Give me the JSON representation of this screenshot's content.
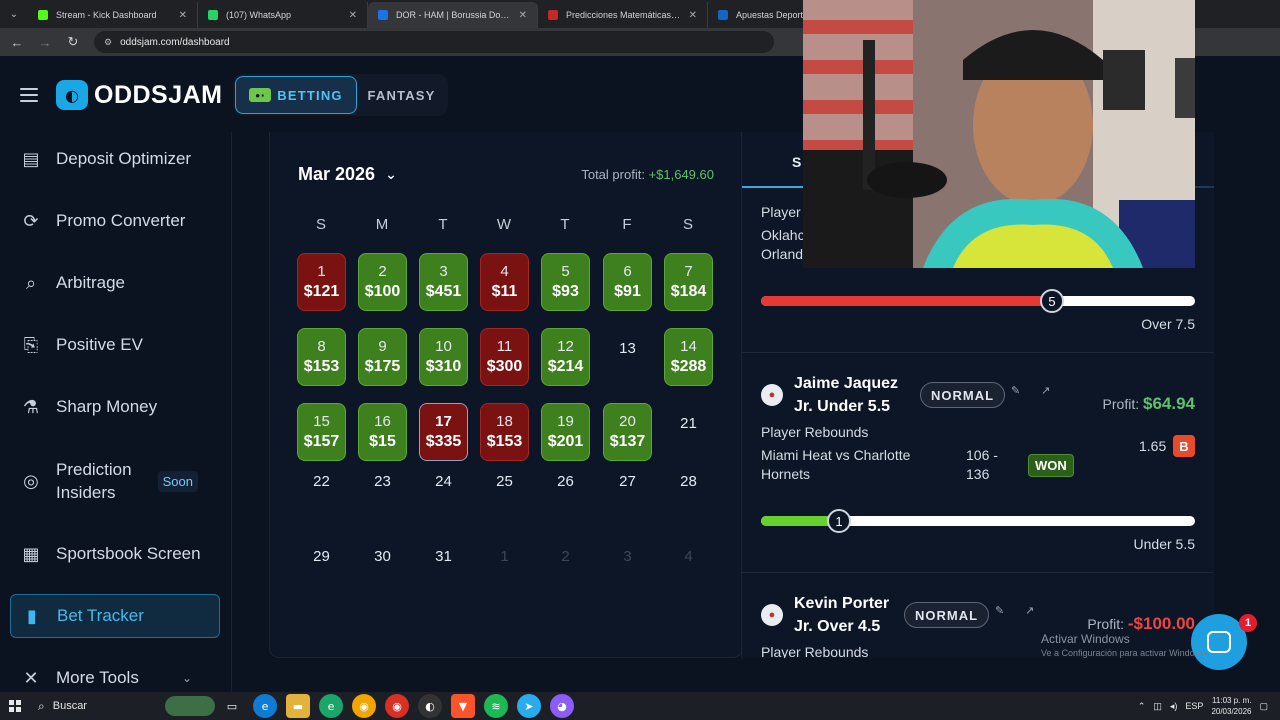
{
  "browser": {
    "tabs": [
      {
        "title": "Stream - Kick Dashboard",
        "color": "#53fc18",
        "active": false
      },
      {
        "title": "(107) WhatsApp",
        "color": "#25d366",
        "active": false
      },
      {
        "title": "DOR - HAM | Borussia Dortmund",
        "color": "#1a73e8",
        "active": true
      },
      {
        "title": "Predicciones Matemáticas de F",
        "color": "#c62828",
        "active": false
      },
      {
        "title": "Apuestas Deportivas | Casa de A",
        "color": "#1565c0",
        "active": false
      }
    ],
    "url": "oddsjam.com/dashboard"
  },
  "app": {
    "logo_text": "ODDSJAM",
    "modes": {
      "betting": "BETTING",
      "fantasy": "FANTASY"
    }
  },
  "sidebar": {
    "items": [
      {
        "label": "Deposit Optimizer",
        "icon": "wallet-icon"
      },
      {
        "label": "Promo Converter",
        "icon": "dollar-cycle-icon"
      },
      {
        "label": "Arbitrage",
        "icon": "magnifier-dollar-icon"
      },
      {
        "label": "Positive EV",
        "icon": "clipboard-icon"
      },
      {
        "label": "Sharp Money",
        "icon": "flask-icon"
      },
      {
        "label": "Prediction",
        "label2": "Insiders",
        "badge": "Soon",
        "icon": "fingerprint-icon"
      },
      {
        "label": "Sportsbook Screen",
        "icon": "grid-icon"
      },
      {
        "label": "Bet Tracker",
        "icon": "bar-chart-icon",
        "active": true
      },
      {
        "label": "More Tools",
        "icon": "tools-icon"
      }
    ]
  },
  "calendar": {
    "month_label": "Mar 2026",
    "total_profit_label": "Total profit:",
    "total_profit_value": "+$1,649.60",
    "weekdays": [
      "S",
      "M",
      "T",
      "W",
      "T",
      "F",
      "S"
    ],
    "weeks": [
      [
        {
          "d": "1",
          "amt": "$121",
          "s": "loss"
        },
        {
          "d": "2",
          "amt": "$100",
          "s": "win"
        },
        {
          "d": "3",
          "amt": "$451",
          "s": "win"
        },
        {
          "d": "4",
          "amt": "$11",
          "s": "loss"
        },
        {
          "d": "5",
          "amt": "$93",
          "s": "win"
        },
        {
          "d": "6",
          "amt": "$91",
          "s": "win"
        },
        {
          "d": "7",
          "amt": "$184",
          "s": "win"
        }
      ],
      [
        {
          "d": "8",
          "amt": "$153",
          "s": "win"
        },
        {
          "d": "9",
          "amt": "$175",
          "s": "win"
        },
        {
          "d": "10",
          "amt": "$310",
          "s": "win"
        },
        {
          "d": "11",
          "amt": "$300",
          "s": "loss"
        },
        {
          "d": "12",
          "amt": "$214",
          "s": "win"
        },
        {
          "d": "13",
          "amt": "",
          "s": "plain"
        },
        {
          "d": "14",
          "amt": "$288",
          "s": "win"
        }
      ],
      [
        {
          "d": "15",
          "amt": "$157",
          "s": "win"
        },
        {
          "d": "16",
          "amt": "$15",
          "s": "win"
        },
        {
          "d": "17",
          "amt": "$335",
          "s": "loss",
          "today": true
        },
        {
          "d": "18",
          "amt": "$153",
          "s": "loss"
        },
        {
          "d": "19",
          "amt": "$201",
          "s": "win"
        },
        {
          "d": "20",
          "amt": "$137",
          "s": "win"
        },
        {
          "d": "21",
          "amt": "",
          "s": "plain"
        }
      ],
      [
        {
          "d": "22",
          "amt": "",
          "s": "plain"
        },
        {
          "d": "23",
          "amt": "",
          "s": "plain"
        },
        {
          "d": "24",
          "amt": "",
          "s": "plain"
        },
        {
          "d": "25",
          "amt": "",
          "s": "plain"
        },
        {
          "d": "26",
          "amt": "",
          "s": "plain"
        },
        {
          "d": "27",
          "amt": "",
          "s": "plain"
        },
        {
          "d": "28",
          "amt": "",
          "s": "plain"
        }
      ],
      [
        {
          "d": "29",
          "amt": "",
          "s": "plain"
        },
        {
          "d": "30",
          "amt": "",
          "s": "plain"
        },
        {
          "d": "31",
          "amt": "",
          "s": "plain"
        },
        {
          "d": "1",
          "amt": "",
          "s": "muted"
        },
        {
          "d": "2",
          "amt": "",
          "s": "muted"
        },
        {
          "d": "3",
          "amt": "",
          "s": "muted"
        },
        {
          "d": "4",
          "amt": "",
          "s": "muted"
        }
      ]
    ]
  },
  "bets_panel": {
    "tab_label": "S",
    "partial": {
      "line1": "Player",
      "line2": "Oklahc",
      "line3": "Orland",
      "slider_value": "5",
      "slider_fraction": 0.67,
      "line_label": "Over 7.5"
    },
    "bets": [
      {
        "player_line1": "Jaime Jaquez",
        "player_line2": "Jr. Under 5.5",
        "badge": "NORMAL",
        "profit_label": "Profit:",
        "profit_value": "$64.94",
        "market": "Player Rebounds",
        "game_line1": "Miami Heat vs Charlotte",
        "game_line2": "Hornets",
        "score_line1": "106 -",
        "score_line2": "136",
        "result": "WON",
        "odds": "1.65",
        "book_letter": "B",
        "slider_value": "1",
        "slider_fraction": 0.18,
        "line_label": "Under 5.5"
      },
      {
        "player_line1": "Kevin Porter",
        "player_line2": "Jr. Over 4.5",
        "badge": "NORMAL",
        "profit_label": "Profit:",
        "profit_value": "-$100.00",
        "market": "Player Rebounds"
      }
    ]
  },
  "overlay": {
    "chat_badge": "1",
    "watermark_title": "Activar Windows",
    "watermark_sub": "Ve a Configuración para activar Windows."
  },
  "taskbar": {
    "search_label": "Buscar",
    "lang": "ESP",
    "time": "11:03 p. m.",
    "date": "20/03/2026"
  },
  "colors": {
    "accent": "#3fb6ee",
    "win": "#3e7f1e",
    "loss": "#7a1212",
    "profit_positive": "#5ec26a",
    "profit_negative": "#ef4444",
    "slider_red": "#e53935",
    "slider_green": "#66d12e"
  }
}
